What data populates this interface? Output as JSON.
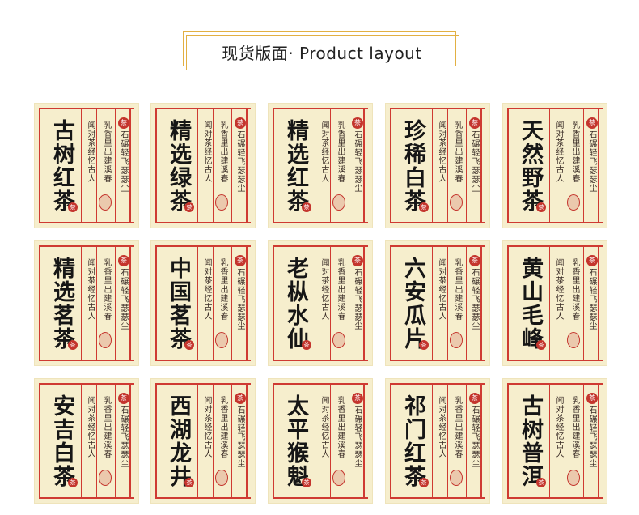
{
  "header": {
    "title": "现货版面· Product layout"
  },
  "labels": [
    {
      "name": "古树红茶"
    },
    {
      "name": "精选绿茶"
    },
    {
      "name": "精选红茶"
    },
    {
      "name": "珍稀白茶"
    },
    {
      "name": "天然野茶"
    },
    {
      "name": "精选茗茶"
    },
    {
      "name": "中国茗茶"
    },
    {
      "name": "老枞水仙"
    },
    {
      "name": "六安瓜片"
    },
    {
      "name": "黄山毛峰"
    },
    {
      "name": "安吉白茶"
    },
    {
      "name": "西湖龙井"
    },
    {
      "name": "太平猴魁"
    },
    {
      "name": "祁门红茶"
    },
    {
      "name": "古树普洱"
    }
  ],
  "poem": {
    "line1": "闻对茶经忆古人",
    "line2": "乳香里出建溪春",
    "line3": "世间绝品人难识",
    "line4": "石碾轻飞瑟瑟尘",
    "seal": "茶"
  }
}
